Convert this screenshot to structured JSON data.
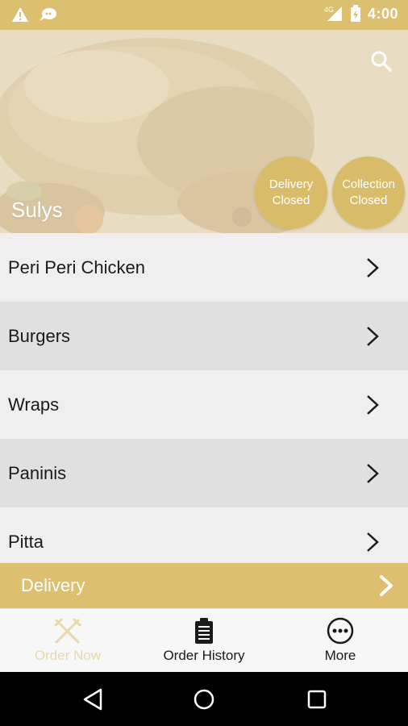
{
  "status_bar": {
    "time": "4:00",
    "network": "4G",
    "left_icons": [
      "warning-icon",
      "notification-icon"
    ],
    "right_icons": [
      "signal-icon",
      "battery-icon"
    ]
  },
  "hero": {
    "restaurant_name": "Sulys",
    "search_icon": "search-icon",
    "delivery_status": {
      "line1": "Delivery",
      "line2": "Closed"
    },
    "collection_status": {
      "line1": "Collection",
      "line2": "Closed"
    }
  },
  "menu": {
    "items": [
      {
        "label": "Peri Peri Chicken"
      },
      {
        "label": "Burgers"
      },
      {
        "label": "Wraps"
      },
      {
        "label": "Paninis"
      },
      {
        "label": "Pitta"
      }
    ]
  },
  "delivery_bar": {
    "label": "Delivery"
  },
  "bottom_nav": {
    "items": [
      {
        "label": "Order Now",
        "icon": "fork-knife-icon",
        "active": true
      },
      {
        "label": "Order History",
        "icon": "clipboard-icon",
        "active": false
      },
      {
        "label": "More",
        "icon": "more-dots-icon",
        "active": false
      }
    ]
  },
  "android_nav": {
    "buttons": [
      "back-icon",
      "home-icon",
      "recents-icon"
    ]
  },
  "colors": {
    "accent": "#dcc070",
    "pill": "#d9bc6a",
    "row_light": "#efefef",
    "row_dark": "#e0e0e0",
    "active_nav": "#ead9a8"
  }
}
